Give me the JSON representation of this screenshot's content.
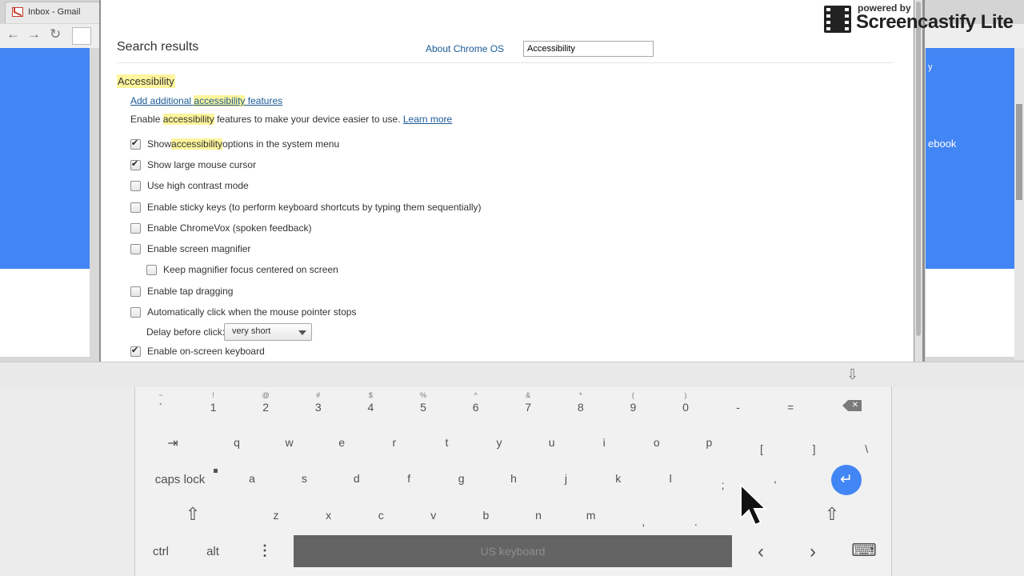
{
  "background_browser": {
    "tab_title": "Inbox - Gmail",
    "right_panel_text": "ebook",
    "right_panel_text2": "y"
  },
  "watermark": {
    "powered_by": "powered by",
    "name": "Screencastify Lite"
  },
  "dialog": {
    "title": "Search results",
    "about_link": "About Chrome OS",
    "search_value": "Accessibility",
    "section_heading": "Accessibility",
    "add_link_pre": "Add additional ",
    "add_link_hl": "accessibility",
    "add_link_post": " features",
    "desc_pre": "Enable ",
    "desc_hl": "accessibility",
    "desc_post": " features to make your device easier to use. ",
    "learn_more": "Learn more",
    "options": {
      "show_menu_pre": "Show ",
      "show_menu_hl": "accessibility",
      "show_menu_post": " options in the system menu",
      "large_cursor": "Show large mouse cursor",
      "high_contrast": "Use high contrast mode",
      "sticky_keys": "Enable sticky keys (to perform keyboard shortcuts by typing them sequentially)",
      "chromevox": "Enable ChromeVox (spoken feedback)",
      "magnifier": "Enable screen magnifier",
      "magnifier_focus": "Keep magnifier focus centered on screen",
      "tap_dragging": "Enable tap dragging",
      "auto_click": "Automatically click when the mouse pointer stops",
      "delay_label": "Delay before click:",
      "delay_value": "very short",
      "onscreen_keyboard": "Enable on-screen keyboard"
    },
    "checked": {
      "show_menu": true,
      "large_cursor": true,
      "high_contrast": false,
      "sticky_keys": false,
      "chromevox": false,
      "magnifier": false,
      "magnifier_focus": false,
      "tap_dragging": false,
      "auto_click": false,
      "onscreen_keyboard": true
    }
  },
  "keyboard": {
    "row1_shift": [
      "~",
      "!",
      "@",
      "#",
      "$",
      "%",
      "^",
      "&",
      "*",
      "(",
      ")",
      "",
      ""
    ],
    "row1": [
      "`",
      "1",
      "2",
      "3",
      "4",
      "5",
      "6",
      "7",
      "8",
      "9",
      "0",
      "-",
      "="
    ],
    "row2": [
      "q",
      "w",
      "e",
      "r",
      "t",
      "y",
      "u",
      "i",
      "o",
      "p",
      "[",
      "]",
      "\\"
    ],
    "row3": [
      "a",
      "s",
      "d",
      "f",
      "g",
      "h",
      "j",
      "k",
      "l",
      ";",
      "'"
    ],
    "row4": [
      "z",
      "x",
      "c",
      "v",
      "b",
      "n",
      "m",
      ",",
      "."
    ],
    "tab": "⇥",
    "caps_lock": "caps lock",
    "shift": "⇧",
    "enter": "↵",
    "ctrl": "ctrl",
    "alt": "alt",
    "more": "⋮",
    "space_label": "US keyboard",
    "left": "‹",
    "right": "›",
    "hide": "⌨",
    "dismiss": "⇩"
  },
  "colors": {
    "highlight": "#fef59c",
    "link": "#1a5a96",
    "bg_blue": "#4285f4",
    "enter_key": "#4285f4"
  }
}
